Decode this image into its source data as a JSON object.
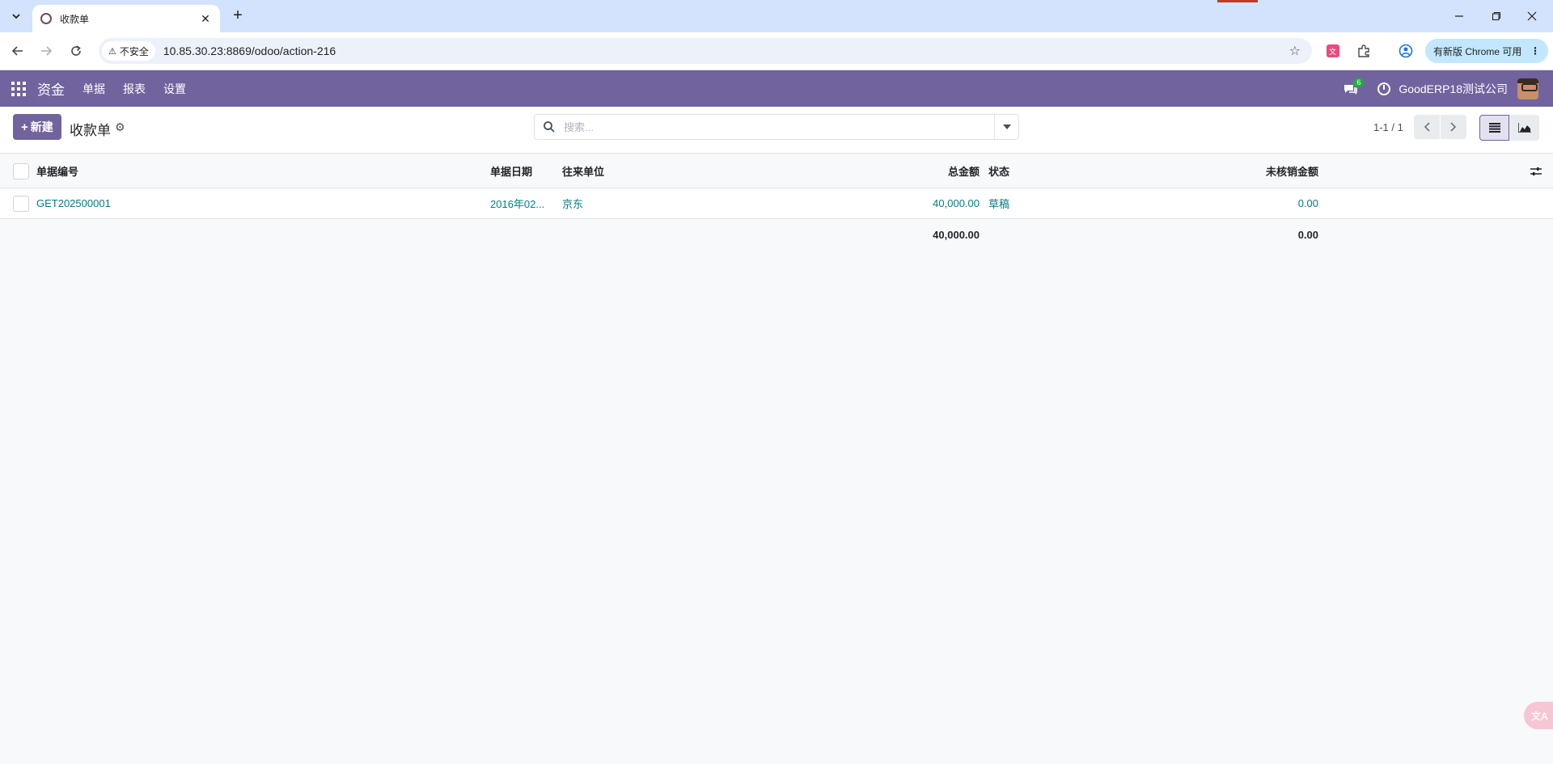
{
  "browser": {
    "tab_title": "收款单",
    "security_label": "不安全",
    "url": "10.85.30.23:8869/odoo/action-216",
    "update_label": "有新版 Chrome 可用"
  },
  "navbar": {
    "app_name": "资金",
    "menu": [
      "单据",
      "报表",
      "设置"
    ],
    "message_count": "6",
    "company": "GoodERP18测试公司",
    "color": "#71639e"
  },
  "control_panel": {
    "new_label": "新建",
    "breadcrumb": "收款单",
    "search_placeholder": "搜索...",
    "pager": "1-1 / 1"
  },
  "table": {
    "columns": {
      "number": "单据编号",
      "date": "单据日期",
      "partner": "往来单位",
      "amount": "总金额",
      "state": "状态",
      "unreconciled": "未核销金额"
    },
    "rows": [
      {
        "number": "GET202500001",
        "date": "2016年02...",
        "partner": "京东",
        "amount": "40,000.00",
        "state": "草稿",
        "unreconciled": "0.00"
      }
    ],
    "totals": {
      "amount": "40,000.00",
      "unreconciled": "0.00"
    }
  }
}
